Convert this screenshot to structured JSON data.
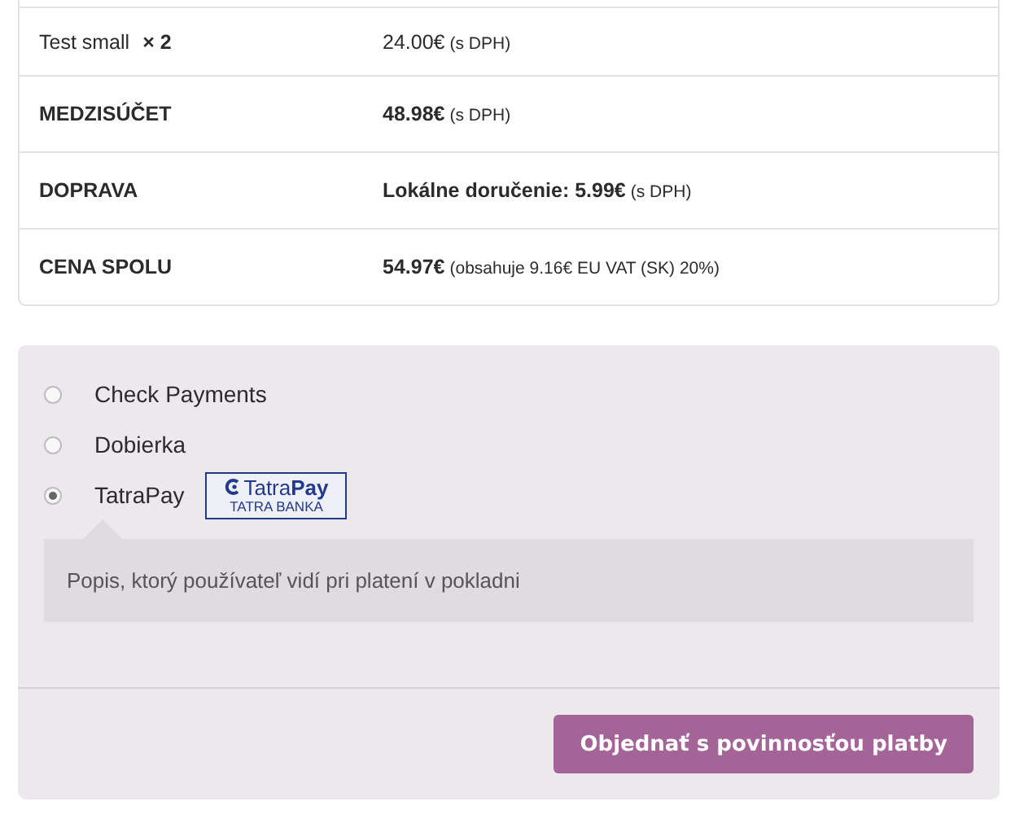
{
  "order_rows": [
    {
      "kind": "item",
      "label": "Test small",
      "quantity": "× 2",
      "amount": "24.00€",
      "note": "(s DPH)"
    },
    {
      "kind": "total",
      "label": "MEDZISÚČET",
      "amount": "48.98€",
      "note": "(s DPH)"
    },
    {
      "kind": "total",
      "label": "DOPRAVA",
      "amount": "Lokálne doručenie: 5.99€",
      "note": "(s DPH)"
    },
    {
      "kind": "total",
      "label": "CENA SPOLU",
      "amount": "54.97€",
      "note": "(obsahuje 9.16€ EU VAT (SK) 20%)"
    }
  ],
  "payment_methods": [
    {
      "label": "Check Payments",
      "selected": false
    },
    {
      "label": "Dobierka",
      "selected": false
    },
    {
      "label": "TatraPay",
      "selected": true,
      "logo": {
        "brand_light": "Tatra",
        "brand_bold": "Pay",
        "bank": "TATRA BANKA"
      }
    }
  ],
  "payment_description": "Popis, ktorý používateľ vidí pri platení v pokladni",
  "submit_button": "Objednať s povinnosťou platby"
}
